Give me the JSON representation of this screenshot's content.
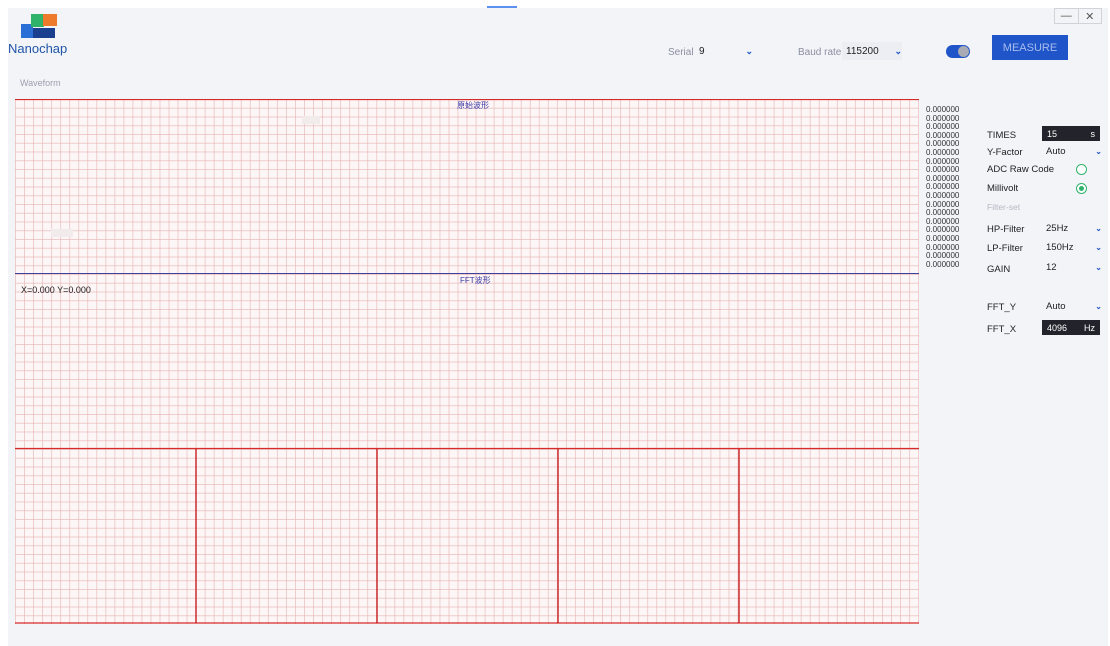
{
  "app": {
    "brand": "Nanochap"
  },
  "window_controls": {
    "minimize": "—",
    "close": "✕"
  },
  "toolbar": {
    "serial_label": "Serial",
    "serial_value": "9",
    "baud_label": "Baud rate",
    "baud_value": "115200",
    "toggle_on": true,
    "measure_label": "MEASURE"
  },
  "waveform": {
    "section_label": "Waveform",
    "raw_title": "原始波形",
    "fft_title": "FFT波形",
    "coord_readout": "X=0.000 Y=0.000",
    "values": [
      "0.000000",
      "0.000000",
      "0.000000",
      "0.000000",
      "0.000000",
      "0.000000",
      "0.000000",
      "0.000000",
      "0.000000",
      "0.000000",
      "0.000000",
      "0.000000",
      "0.000000",
      "0.000000",
      "0.000000",
      "0.000000",
      "0.000000",
      "0.000000",
      "0.000000"
    ]
  },
  "settings": {
    "times_label": "TIMES",
    "times_value": "15",
    "times_unit": "s",
    "yfactor_label": "Y-Factor",
    "yfactor_value": "Auto",
    "adc_label": "ADC Raw Code",
    "adc_checked": false,
    "millivolt_label": "Millivolt",
    "millivolt_checked": true,
    "filter_set_label": "Filter-set",
    "hp_label": "HP-Filter",
    "hp_value": "25Hz",
    "lp_label": "LP-Filter",
    "lp_value": "150Hz",
    "gain_label": "GAIN",
    "gain_value": "12",
    "ffty_label": "FFT_Y",
    "ffty_value": "Auto",
    "fftx_label": "FFT_X",
    "fftx_value": "4096",
    "fftx_unit": "Hz"
  },
  "colors": {
    "accent": "#1f55c8",
    "plot_line": "#d42a2a",
    "plot_divider": "#4040a0",
    "radio": "#2fb36a"
  }
}
